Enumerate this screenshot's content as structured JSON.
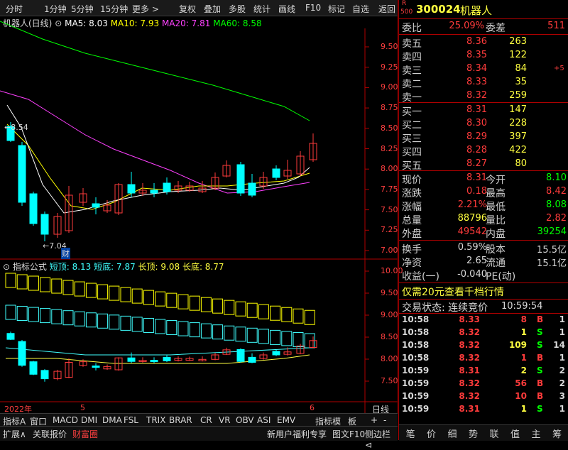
{
  "toolbar": {
    "items": [
      "分时",
      "1分钟",
      "5分钟",
      "15分钟",
      "更多 >",
      "复权",
      "叠加",
      "多股",
      "统计",
      "画线",
      "F10",
      "标记",
      "自选",
      "返回"
    ]
  },
  "stock": {
    "badge_r": "R",
    "badge_num": "500",
    "code": "300024",
    "name": "机器人"
  },
  "ma_bar": {
    "title": "机器人(日线)",
    "ma5": "MA5: 8.03",
    "ma10": "MA10: 7.93",
    "ma20": "MA20: 7.81",
    "ma60": "MA60: 8.58"
  },
  "price_axis": [
    "9.50",
    "9.25",
    "9.00",
    "8.75",
    "8.50",
    "8.25",
    "8.00",
    "7.75",
    "7.50",
    "7.25",
    "7.00"
  ],
  "price_marks": {
    "high": "8.54",
    "low": "7.04",
    "cai": "财"
  },
  "indicator_bar": {
    "title": "指标公式",
    "short_top": "短顶: 8.13",
    "short_bottom": "短底: 7.87",
    "long_top": "长顶: 9.08",
    "long_bottom": "长底: 8.77"
  },
  "indicator_axis": [
    "10.00",
    "9.50",
    "9.00",
    "8.50",
    "8.00",
    "7.50"
  ],
  "date_axis": {
    "year": "2022年",
    "m5": "5",
    "m6": "6",
    "period": "日线"
  },
  "quote": {
    "weibi_lbl": "委比",
    "weibi_val": "25.09%",
    "weicha_lbl": "委差",
    "weicha_val": "511",
    "asks": [
      {
        "label": "卖五",
        "price": "8.36",
        "vol": "263",
        "chg": ""
      },
      {
        "label": "卖四",
        "price": "8.35",
        "vol": "122",
        "chg": ""
      },
      {
        "label": "卖三",
        "price": "8.34",
        "vol": "84",
        "chg": "+5"
      },
      {
        "label": "卖二",
        "price": "8.33",
        "vol": "35",
        "chg": ""
      },
      {
        "label": "卖一",
        "price": "8.32",
        "vol": "259",
        "chg": ""
      }
    ],
    "bids": [
      {
        "label": "买一",
        "price": "8.31",
        "vol": "147"
      },
      {
        "label": "买二",
        "price": "8.30",
        "vol": "228"
      },
      {
        "label": "买三",
        "price": "8.29",
        "vol": "397"
      },
      {
        "label": "买四",
        "price": "8.28",
        "vol": "422"
      },
      {
        "label": "买五",
        "price": "8.27",
        "vol": "80"
      }
    ],
    "stats": [
      {
        "l1": "现价",
        "v1": "8.31",
        "l2": "今开",
        "v2": "8.10"
      },
      {
        "l1": "涨跌",
        "v1": "0.18",
        "l2": "最高",
        "v2": "8.42"
      },
      {
        "l1": "涨幅",
        "v1": "2.21%",
        "l2": "最低",
        "v2": "8.08"
      },
      {
        "l1": "总量",
        "v1": "88796",
        "l2": "量比",
        "v2": "2.82"
      },
      {
        "l1": "外盘",
        "v1": "49542",
        "l2": "内盘",
        "v2": "39254"
      }
    ],
    "stats2": [
      {
        "l1": "换手",
        "v1": "0.59%",
        "l2": "股本",
        "v2": "15.5亿"
      },
      {
        "l1": "净资",
        "v1": "2.65",
        "l2": "流通",
        "v2": "15.1亿"
      },
      {
        "l1": "收益(一)",
        "v1": "-0.040",
        "l2": "PE(动)",
        "v2": ""
      }
    ],
    "promo": "仅需20元查看千档行情",
    "trade_status": "交易状态: 连续竞价",
    "trade_time": "10:59:54"
  },
  "ticks": [
    {
      "t": "10:58",
      "p": "8.33",
      "v": "8",
      "bs": "B",
      "n": "1"
    },
    {
      "t": "10:58",
      "p": "8.32",
      "v": "1",
      "bs": "S",
      "n": "1"
    },
    {
      "t": "10:58",
      "p": "8.32",
      "v": "109",
      "bs": "S",
      "n": "14"
    },
    {
      "t": "10:58",
      "p": "8.32",
      "v": "1",
      "bs": "B",
      "n": "1"
    },
    {
      "t": "10:59",
      "p": "8.31",
      "v": "2",
      "bs": "S",
      "n": "2"
    },
    {
      "t": "10:59",
      "p": "8.32",
      "v": "56",
      "bs": "B",
      "n": "2"
    },
    {
      "t": "10:59",
      "p": "8.32",
      "v": "10",
      "bs": "B",
      "n": "3"
    },
    {
      "t": "10:59",
      "p": "8.31",
      "v": "1",
      "bs": "S",
      "n": "1"
    }
  ],
  "bottom_tabs1": [
    "指标A",
    "窗口",
    "MACD",
    "DMI",
    "DMA",
    "FSL",
    "TRIX",
    "BRAR",
    "CR",
    "VR",
    "OBV",
    "ASI",
    "EMV",
    "指标模",
    "板",
    "+",
    "-"
  ],
  "bottom_tabs2": [
    "扩展∧",
    "关联报价",
    "财富圈",
    "新用户福利专享",
    "图文F10",
    "侧边栏⊲"
  ],
  "right_tabs": [
    "笔",
    "价",
    "细",
    "势",
    "联",
    "值",
    "主",
    "筹"
  ],
  "colors": {
    "up": "#ff3b3b",
    "down": "#00ffff",
    "ma5": "#ffffff",
    "ma10": "#ffff00",
    "ma20": "#ff40ff",
    "ma60": "#00ff00"
  }
}
